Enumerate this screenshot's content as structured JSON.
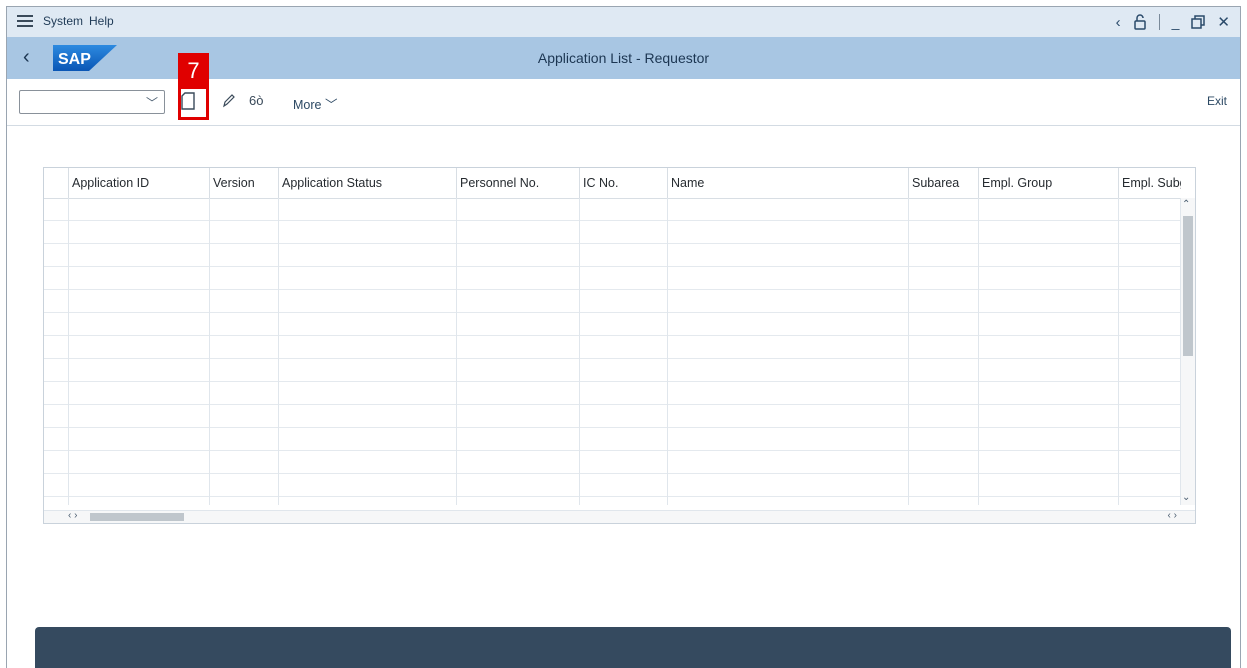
{
  "menubar": {
    "items": [
      "System",
      "Help"
    ]
  },
  "title": "Application List - Requestor",
  "logo_text": "SAP",
  "toolbar": {
    "more_label": "More",
    "exit_label": "Exit"
  },
  "annotation": {
    "step": "7",
    "color": "#e00000"
  },
  "table": {
    "columns": [
      "Application ID",
      "Version",
      "Application Status",
      "Personnel No.",
      "IC No.",
      "Name",
      "Subarea",
      "Empl. Group",
      "Empl. Subg"
    ],
    "row_count": 13
  },
  "colors": {
    "menubar": "#dfe9f3",
    "titlebar": "#a8c6e3",
    "statusbar": "#354a5f"
  }
}
